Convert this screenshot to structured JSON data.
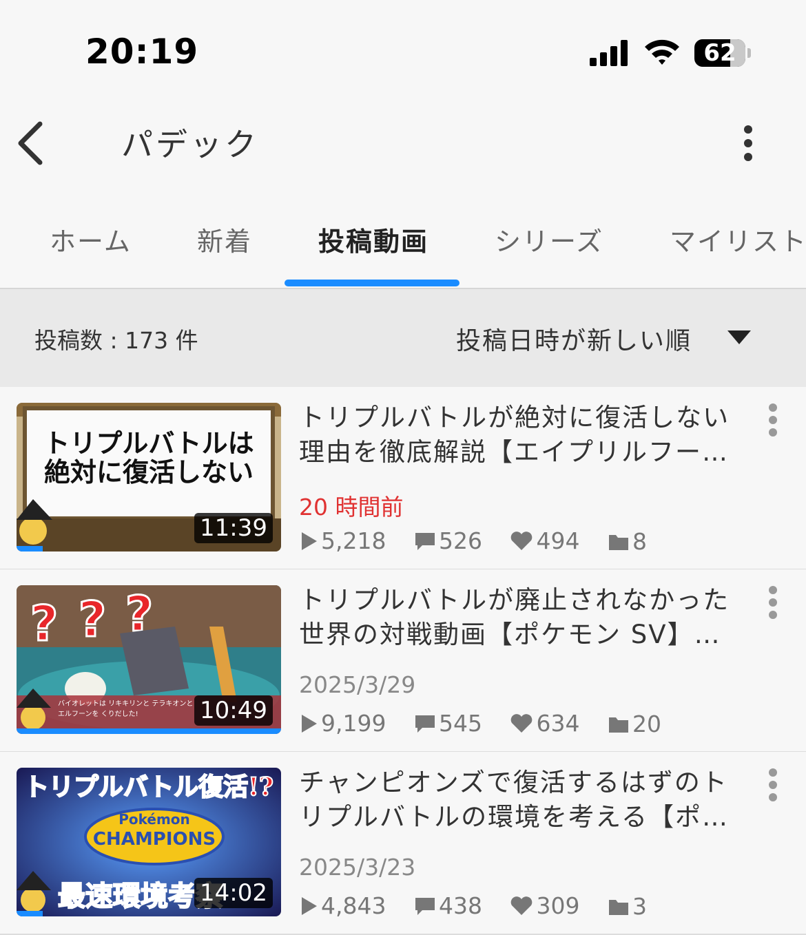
{
  "status_bar": {
    "time": "20:19",
    "battery": "62"
  },
  "header": {
    "title": "パデック"
  },
  "tabs": [
    {
      "label": "ホーム"
    },
    {
      "label": "新着"
    },
    {
      "label": "投稿動画"
    },
    {
      "label": "シリーズ"
    },
    {
      "label": "マイリスト"
    }
  ],
  "active_tab": "投稿動画",
  "sortbar": {
    "count": "投稿数 : 173 件",
    "sort_label": "投稿日時が新しい順"
  },
  "videos": [
    {
      "title": "トリプルバトルが絶対に復活しない理由を徹底解説【エイプリルフール…",
      "thumb_text": [
        "トリプルバトルは",
        "絶対に復活しない"
      ],
      "duration": "11:39",
      "watched_fraction": 0.1,
      "date": "20 時間前",
      "views": "5,218",
      "comments": "526",
      "likes": "494",
      "mylists": "8"
    },
    {
      "title": "トリプルバトルが廃止されなかった世界の対戦動画【ポケモン SV】【ゆ…",
      "thumb_text": [
        "バイオレットは リキキリンと テラキオンと",
        "エルフーンを くりだした!"
      ],
      "duration": "10:49",
      "watched_fraction": 1.0,
      "date": "2025/3/29",
      "views": "9,199",
      "comments": "545",
      "likes": "634",
      "mylists": "20"
    },
    {
      "title": "チャンピオンズで復活するはずのトリプルバトルの環境を考える【ポケ…",
      "thumb_text": [
        "トリプルバトル復活!?",
        "Pokémon",
        "CHAMPIONS",
        "最速環境考察"
      ],
      "duration": "14:02",
      "watched_fraction": 0.1,
      "date": "2025/3/23",
      "views": "4,843",
      "comments": "438",
      "likes": "309",
      "mylists": "3"
    }
  ],
  "colors": {
    "accent": "#1a8cff",
    "recent_date": "#e03232"
  },
  "icons": [
    "back-chevron-icon",
    "more-vertical-icon",
    "caret-down-icon",
    "play-icon",
    "comment-icon",
    "heart-icon",
    "folder-icon"
  ]
}
